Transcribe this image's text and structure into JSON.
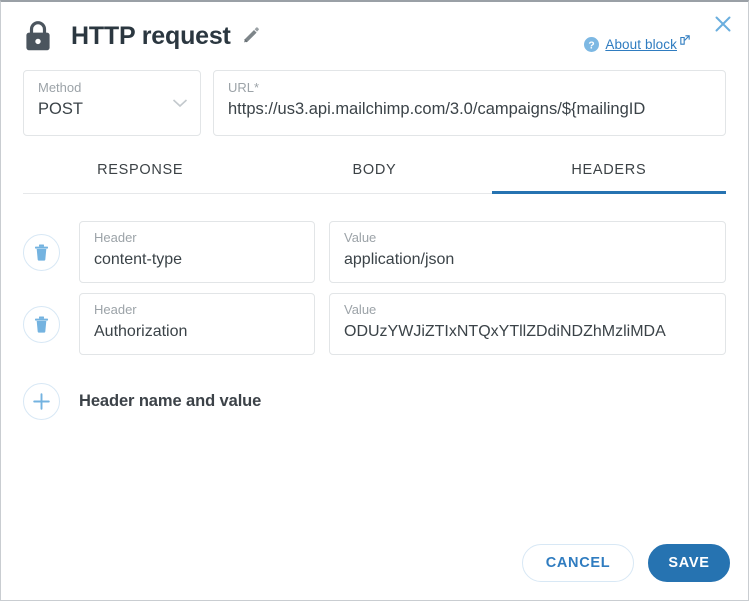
{
  "window": {
    "title": "HTTP request",
    "lock_icon": "lock-icon",
    "edit_icon": "pencil-icon",
    "close_icon": "close-icon",
    "accent_color": "#2673b1",
    "link_color": "#2f7cc0",
    "light_blue": "#7db8e3"
  },
  "help": {
    "icon": "question-mark-icon",
    "label": "About block",
    "external_icon": "external-link-icon"
  },
  "request": {
    "method": {
      "label": "Method",
      "value": "POST",
      "chevron_icon": "chevron-down-icon"
    },
    "url": {
      "label": "URL*",
      "value": "https://us3.api.mailchimp.com/3.0/campaigns/${mailingID"
    }
  },
  "tabs": [
    {
      "label": "RESPONSE",
      "active": false
    },
    {
      "label": "BODY",
      "active": false
    },
    {
      "label": "HEADERS",
      "active": true
    }
  ],
  "headers": {
    "name_label": "Header",
    "value_label": "Value",
    "delete_icon": "trash-icon",
    "rows": [
      {
        "name": "content-type",
        "value": "application/json"
      },
      {
        "name": "Authorization",
        "value": "ODUzYWJiZTIxNTQxYTllZDdiNDZhMzliMDA"
      }
    ],
    "add": {
      "icon": "plus-icon",
      "label": "Header name and value"
    }
  },
  "footer": {
    "cancel_label": "CANCEL",
    "save_label": "SAVE"
  }
}
